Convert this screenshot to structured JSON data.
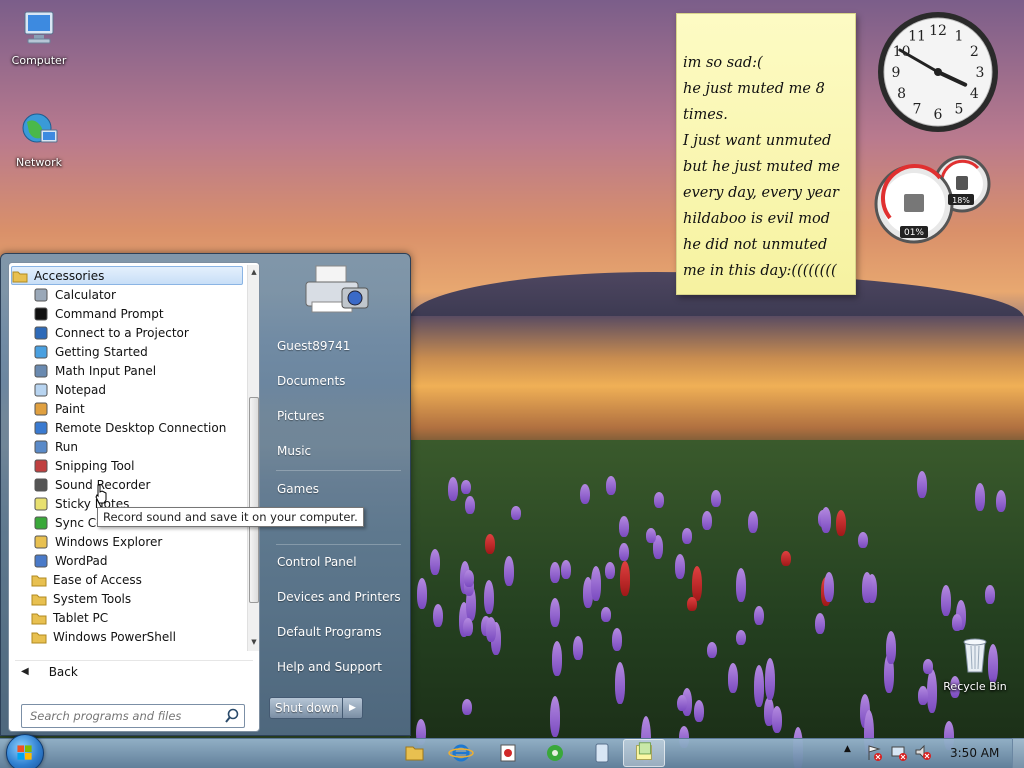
{
  "desktop": {
    "icons": [
      {
        "label": "Computer",
        "icon": "computer-icon"
      },
      {
        "label": "Network",
        "icon": "network-icon"
      },
      {
        "label": "Recycle Bin",
        "icon": "recycle-bin-icon"
      }
    ]
  },
  "sticky_note": {
    "lines": [
      "im so sad:(",
      "he just muted me 8",
      "times.",
      "I just want unmuted",
      "but he just muted me",
      "every day, every year",
      "hildaboo is evil mod",
      "he did not unmuted",
      "me in this day:(((((((("
    ]
  },
  "clock_gadget": {
    "numerals": [
      "12",
      "1",
      "2",
      "3",
      "4",
      "5",
      "6",
      "7",
      "8",
      "9",
      "10",
      "11"
    ],
    "hour": 3,
    "minute": 50
  },
  "meter_gadget": {
    "cpu_label": "01%",
    "memory_label": "18%"
  },
  "start_menu": {
    "programs_header": "Accessories",
    "programs": [
      {
        "label": "Calculator",
        "icon": "calculator-icon"
      },
      {
        "label": "Command Prompt",
        "icon": "command-prompt-icon"
      },
      {
        "label": "Connect to a Projector",
        "icon": "projector-icon"
      },
      {
        "label": "Getting Started",
        "icon": "getting-started-icon"
      },
      {
        "label": "Math Input Panel",
        "icon": "math-input-icon"
      },
      {
        "label": "Notepad",
        "icon": "notepad-icon"
      },
      {
        "label": "Paint",
        "icon": "paint-icon"
      },
      {
        "label": "Remote Desktop Connection",
        "icon": "remote-desktop-icon"
      },
      {
        "label": "Run",
        "icon": "run-icon"
      },
      {
        "label": "Snipping Tool",
        "icon": "snipping-tool-icon"
      },
      {
        "label": "Sound Recorder",
        "icon": "sound-recorder-icon"
      },
      {
        "label": "Sticky Notes",
        "icon": "sticky-notes-icon"
      },
      {
        "label": "Sync Center",
        "icon": "sync-center-icon"
      },
      {
        "label": "Windows Explorer",
        "icon": "explorer-icon"
      },
      {
        "label": "WordPad",
        "icon": "wordpad-icon"
      },
      {
        "label": "Ease of Access",
        "icon": "folder-icon"
      },
      {
        "label": "System Tools",
        "icon": "folder-icon"
      },
      {
        "label": "Tablet PC",
        "icon": "folder-icon"
      },
      {
        "label": "Windows PowerShell",
        "icon": "folder-icon"
      }
    ],
    "back_label": "Back",
    "search_placeholder": "Search programs and files",
    "right_items": {
      "user": "Guest89741",
      "documents": "Documents",
      "pictures": "Pictures",
      "music": "Music",
      "games": "Games",
      "control_panel": "Control Panel",
      "devices": "Devices and Printers",
      "default_programs": "Default Programs",
      "help": "Help and Support"
    },
    "shutdown_label": "Shut down",
    "tooltip": "Record sound and save it on your computer."
  },
  "taskbar": {
    "pinned": [
      "explorer-icon",
      "internet-explorer-icon",
      "media-player-icon",
      "media-center-icon",
      "device-stage-icon",
      "sticky-notes-icon"
    ],
    "clock": "3:50 AM"
  }
}
